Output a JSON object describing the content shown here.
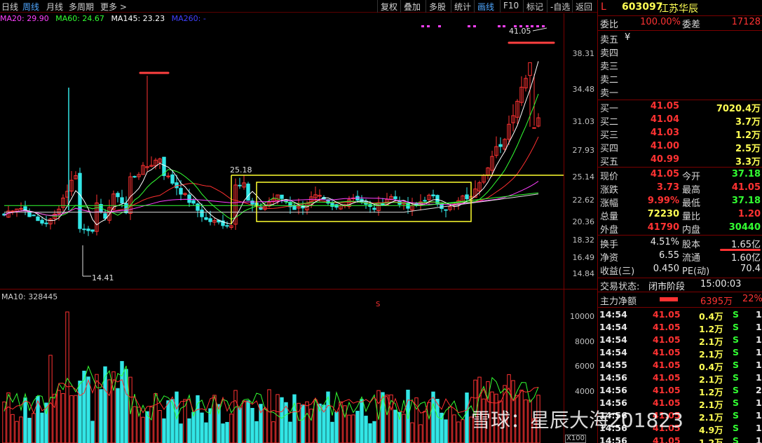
{
  "toolbar": {
    "left": [
      "日线",
      "周线",
      "月线",
      "多周期",
      "更多 >"
    ],
    "active": "周线",
    "right": [
      "复权",
      "叠加",
      "多股",
      "统计",
      "画线",
      "F10",
      "标记",
      "-自选",
      "返回"
    ],
    "right_active": "画线"
  },
  "ma": {
    "ma20": "MA20: 29.90",
    "ma60": "MA60: 24.67",
    "ma145": "MA145: 23.23",
    "ma260": "MA260: -"
  },
  "volume_label": "MA10: 328445",
  "price_axis": [
    "38.31",
    "34.48",
    "31.03",
    "27.93",
    "25.14",
    "22.62",
    "20.36",
    "18.32",
    "16.49",
    "14.84"
  ],
  "volume_axis": [
    "10000",
    "8000",
    "6000",
    "4000"
  ],
  "volume_unit": "X100",
  "annotations": {
    "high_price": "41.05",
    "low_price": "14.41",
    "box_price": "25.18",
    "s_mark": "S"
  },
  "colors": {
    "up": "#ff3232",
    "down": "#32e6e6",
    "ma20": "#ffffff",
    "ma60": "#32ff32",
    "ma145": "#ff40ff",
    "ma260": "#3030ff",
    "box": "#ffff30",
    "grid": "#7a0000"
  },
  "stock": {
    "market": "L",
    "code": "603097",
    "name": "江苏华辰"
  },
  "order_ratio": {
    "label1": "委比",
    "value1": "100.00%",
    "label2": "委差",
    "value2": "17128"
  },
  "sell_orders": [
    {
      "label": "卖五",
      "price": "¥",
      "volume": ""
    },
    {
      "label": "卖四",
      "price": "",
      "volume": ""
    },
    {
      "label": "卖三",
      "price": "",
      "volume": ""
    },
    {
      "label": "卖二",
      "price": "",
      "volume": ""
    },
    {
      "label": "卖一",
      "price": "",
      "volume": ""
    }
  ],
  "buy_orders": [
    {
      "label": "买一",
      "price": "41.05",
      "volume": "7020.4万"
    },
    {
      "label": "买二",
      "price": "41.04",
      "volume": "3.7万"
    },
    {
      "label": "买三",
      "price": "41.03",
      "volume": "1.2万"
    },
    {
      "label": "买四",
      "price": "41.00",
      "volume": "2.5万"
    },
    {
      "label": "买五",
      "price": "40.99",
      "volume": "3.3万"
    }
  ],
  "quote": [
    {
      "l1": "现价",
      "v1": "41.05",
      "c1": "red",
      "l2": "今开",
      "v2": "37.18",
      "c2": "green"
    },
    {
      "l1": "涨跌",
      "v1": "3.73",
      "c1": "red",
      "l2": "最高",
      "v2": "41.05",
      "c2": "red"
    },
    {
      "l1": "涨幅",
      "v1": "9.99%",
      "c1": "red",
      "l2": "最低",
      "v2": "37.18",
      "c2": "green"
    },
    {
      "l1": "总量",
      "v1": "72230",
      "c1": "yellow",
      "l2": "量比",
      "v2": "1.20",
      "c2": "red"
    },
    {
      "l1": "外盘",
      "v1": "41790",
      "c1": "red",
      "l2": "内盘",
      "v2": "30440",
      "c2": "green"
    }
  ],
  "fundamentals": [
    {
      "l1": "换手",
      "v1": "4.51%",
      "l2": "股本",
      "v2": "1.65亿"
    },
    {
      "l1": "净资",
      "v1": "6.55",
      "l2": "流通",
      "v2": "1.60亿"
    },
    {
      "l1": "收益(三)",
      "v1": "0.450",
      "l2": "PE(动)",
      "v2": "70.4"
    }
  ],
  "trade_status": {
    "label": "交易状态:",
    "value": "闭市阶段",
    "time": "15:00:03"
  },
  "main_flow": {
    "label": "主力净额",
    "value": "6395万",
    "pct": "22%"
  },
  "ticks": [
    {
      "time": "14:54",
      "price": "41.05",
      "vol": "0.4万",
      "dir": "S",
      "n": "1"
    },
    {
      "time": "14:54",
      "price": "41.05",
      "vol": "1.2万",
      "dir": "S",
      "n": "1"
    },
    {
      "time": "14:54",
      "price": "41.05",
      "vol": "2.1万",
      "dir": "S",
      "n": "1"
    },
    {
      "time": "14:54",
      "price": "41.05",
      "vol": "2.1万",
      "dir": "S",
      "n": "1"
    },
    {
      "time": "14:55",
      "price": "41.05",
      "vol": "0.4万",
      "dir": "S",
      "n": "1"
    },
    {
      "time": "14:56",
      "price": "41.05",
      "vol": "2.1万",
      "dir": "S",
      "n": "1"
    },
    {
      "time": "14:56",
      "price": "41.05",
      "vol": "1.2万",
      "dir": "S",
      "n": "2"
    },
    {
      "time": "14:56",
      "price": "41.05",
      "vol": "2.1万",
      "dir": "S",
      "n": "1"
    },
    {
      "time": "14:56",
      "price": "41.05",
      "vol": "2.1万",
      "dir": "S",
      "n": "1"
    },
    {
      "time": "14:56",
      "price": "41.05",
      "vol": "4.9万",
      "dir": "S",
      "n": "1"
    },
    {
      "time": "14:56",
      "price": "41.05",
      "vol": "1.2万",
      "dir": "S",
      "n": "1"
    }
  ],
  "watermark": "雪球：星辰大海201823"
}
